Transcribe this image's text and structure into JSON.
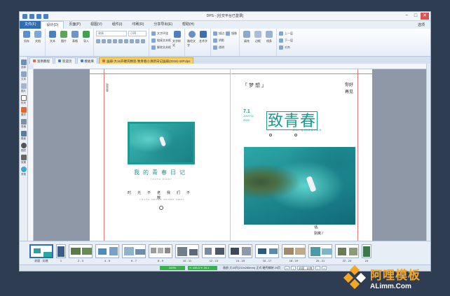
{
  "window": {
    "title": "DPS - [社交平台已登录]"
  },
  "menu": {
    "items": [
      "文件(F)",
      "设计(D)",
      "页面(P)",
      "视图(V)",
      "组件(I)",
      "印刷(R)",
      "分享导出(E)",
      "帮助(H)"
    ],
    "right": "选项"
  },
  "ribbon": {
    "groups": [
      {
        "buttons": [
          "另存",
          "文档"
        ]
      },
      {
        "buttons": [
          "文本",
          "图片",
          "表格",
          "导入"
        ]
      },
      {
        "font_name": "宋体",
        "font_size": "小四"
      },
      {
        "small": [
          "文字环绕",
          "链接文本框",
          "解除文本框"
        ],
        "buttons": [
          "文字样式"
        ]
      },
      {
        "buttons": [
          "路径文字",
          "艺术字"
        ]
      },
      {
        "small": [
          "描边",
          "阴影",
          "透明",
          "镜像"
        ]
      },
      {
        "buttons": [
          "填充",
          "边框",
          "线条"
        ]
      },
      {
        "small": [
          "上一层",
          "下一层",
          "对齐"
        ]
      }
    ]
  },
  "doc_tabs": [
    {
      "label": "案例教程"
    },
    {
      "label": "欢迎页"
    },
    {
      "label": "模板库"
    },
    {
      "label": "画册-大16开硬壳精装-致青春小清新日记画册(2018)-42P.dps"
    }
  ],
  "left_tools": [
    "选择",
    "文本",
    "图片",
    "形状",
    "素材",
    "表格",
    "模板",
    "图层",
    "效果",
    "其他"
  ],
  "page_left": {
    "title": "我的青春日记",
    "title_en": "YOUTH DIARY",
    "poem": "时光不老我们不散",
    "poem_en": "YOUTH NEVER DROPS AWAY",
    "side_text": "致青春"
  },
  "page_right": {
    "tag": "「梦想」",
    "big_title": "致青春",
    "pinyin": "ZHI QINGCHUN",
    "date_main": "7.1",
    "date_sub": "JULY 01",
    "date_year": "2019",
    "corner_text_1": "你好",
    "corner_text_2": "再见",
    "foot_1": "话,",
    "foot_2": "别离 /"
  },
  "thumbnails": [
    {
      "label": "封面 - 封底"
    },
    {
      "label": "1"
    },
    {
      "label": "2 - 3"
    },
    {
      "label": "4 - 5"
    },
    {
      "label": "6 - 7"
    },
    {
      "label": "8 - 9"
    },
    {
      "label": "10 - 11"
    },
    {
      "label": "12 - 13"
    },
    {
      "label": "14 - 15"
    },
    {
      "label": "16 - 17"
    },
    {
      "label": "18 - 19"
    },
    {
      "label": "20 - 21"
    },
    {
      "label": "22 - 23"
    },
    {
      "label": "24"
    }
  ],
  "statusbar": {
    "progress": "100%",
    "coords": "X: 435.3  Y: 34.1",
    "info": "画册 大16开(210x285mm) 正式 硬壳精装 24页",
    "page_label": "封面 - 封底"
  },
  "watermark": {
    "cn": "阿哩模板",
    "en": "ALimm.Com"
  },
  "colors": {
    "accent": "#1d9a93",
    "titlebar": "#2f6db5",
    "active_tab": "#f6d36a"
  }
}
